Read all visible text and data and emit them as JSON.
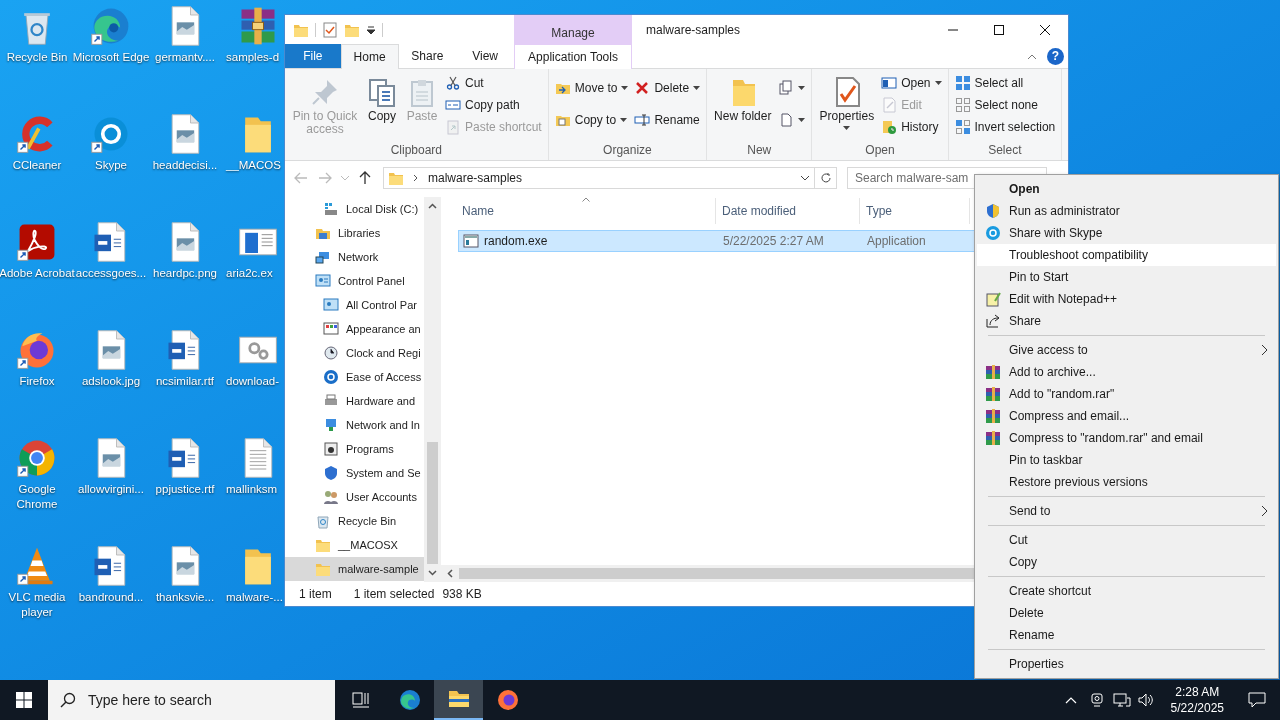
{
  "desktop": {
    "icons": [
      {
        "label": "Recycle Bin",
        "shortcut": false
      },
      {
        "label": "Microsoft Edge",
        "shortcut": true
      },
      {
        "label": "germantv....",
        "shortcut": false
      },
      {
        "label": "samples-d",
        "shortcut": false
      },
      {
        "label": "CCleaner",
        "shortcut": true
      },
      {
        "label": "Skype",
        "shortcut": true
      },
      {
        "label": "headdecisi...",
        "shortcut": false
      },
      {
        "label": "__MACOS",
        "shortcut": false
      },
      {
        "label": "Adobe Acrobat",
        "shortcut": true
      },
      {
        "label": "accessgoes...",
        "shortcut": false
      },
      {
        "label": "heardpc.png",
        "shortcut": false
      },
      {
        "label": "aria2c.ex",
        "shortcut": false
      },
      {
        "label": "Firefox",
        "shortcut": true
      },
      {
        "label": "adslook.jpg",
        "shortcut": false
      },
      {
        "label": "ncsimilar.rtf",
        "shortcut": false
      },
      {
        "label": "download-",
        "shortcut": false
      },
      {
        "label": "Google Chrome",
        "shortcut": true
      },
      {
        "label": "allowvirgini...",
        "shortcut": false
      },
      {
        "label": "ppjustice.rtf",
        "shortcut": false
      },
      {
        "label": "mallinksm",
        "shortcut": false
      },
      {
        "label": "VLC media player",
        "shortcut": true
      },
      {
        "label": "bandround...",
        "shortcut": false
      },
      {
        "label": "thanksvie...",
        "shortcut": false
      },
      {
        "label": "malware-...",
        "shortcut": false
      }
    ]
  },
  "explorer": {
    "title": "malware-samples",
    "context_group": "Manage",
    "tabs": [
      {
        "label": "File",
        "kind": "file",
        "selected": false
      },
      {
        "label": "Home",
        "kind": "tab",
        "selected": true
      },
      {
        "label": "Share",
        "kind": "tab",
        "selected": false
      },
      {
        "label": "View",
        "kind": "tab",
        "selected": false
      },
      {
        "label": "Application Tools",
        "kind": "contextual",
        "selected": false
      }
    ],
    "help": "?",
    "ribbon": [
      {
        "label": "Clipboard",
        "columns": [
          [
            {
              "label": "Pin to Quick access",
              "disabled": true,
              "dropdown": false
            }
          ],
          [
            {
              "label": "Copy",
              "disabled": false,
              "dropdown": false
            }
          ],
          [
            {
              "label": "Paste",
              "disabled": true,
              "dropdown": false
            }
          ],
          [
            {
              "label": "Cut",
              "disabled": false,
              "dropdown": false
            },
            {
              "label": "Copy path",
              "disabled": false,
              "dropdown": false
            },
            {
              "label": "Paste shortcut",
              "disabled": true,
              "dropdown": false
            }
          ]
        ]
      },
      {
        "label": "Organize",
        "columns": [
          [
            {
              "label": "Move to",
              "disabled": false,
              "dropdown": true
            },
            {
              "label": "Copy to",
              "disabled": false,
              "dropdown": true
            }
          ],
          [
            {
              "label": "Delete",
              "disabled": false,
              "dropdown": true
            },
            {
              "label": "Rename",
              "disabled": false,
              "dropdown": false
            }
          ]
        ]
      },
      {
        "label": "New",
        "columns": [
          [
            {
              "label": "New folder",
              "disabled": false,
              "dropdown": false
            }
          ],
          [
            {
              "disabled": false,
              "dropdown": true
            },
            {
              "disabled": false,
              "dropdown": true
            }
          ]
        ]
      },
      {
        "label": "Open",
        "columns": [
          [
            {
              "label": "Properties",
              "disabled": false,
              "dropdown": true
            }
          ],
          [
            {
              "label": "Open",
              "disabled": false,
              "dropdown": true
            },
            {
              "label": "Edit",
              "disabled": true,
              "dropdown": false
            },
            {
              "label": "History",
              "disabled": false,
              "dropdown": false
            }
          ]
        ]
      },
      {
        "label": "Select",
        "columns": [
          [
            {
              "label": "Select all",
              "disabled": false,
              "dropdown": false
            },
            {
              "label": "Select none",
              "disabled": false,
              "dropdown": false
            },
            {
              "label": "Invert selection",
              "disabled": false,
              "dropdown": false
            }
          ]
        ]
      }
    ],
    "address": "malware-samples",
    "search_placeholder": "Search malware-sam",
    "nav_pane": {
      "partial_group": [
        {
          "label": "Local Disk (C:)",
          "selected": false
        }
      ],
      "items": [
        {
          "label": "Libraries",
          "selected": false
        },
        {
          "label": "Network",
          "selected": false
        },
        {
          "label": "Control Panel",
          "selected": false,
          "children": [
            {
              "label": "All Control Par",
              "selected": false
            },
            {
              "label": "Appearance an",
              "selected": false
            },
            {
              "label": "Clock and Regi",
              "selected": false
            },
            {
              "label": "Ease of Access",
              "selected": false
            },
            {
              "label": "Hardware and",
              "selected": false
            },
            {
              "label": "Network and In",
              "selected": false
            },
            {
              "label": "Programs",
              "selected": false
            },
            {
              "label": "System and Se",
              "selected": false
            },
            {
              "label": "User Accounts",
              "selected": false
            }
          ]
        },
        {
          "label": "Recycle Bin",
          "selected": false
        },
        {
          "label": "__MACOSX",
          "selected": false
        },
        {
          "label": "malware-sample",
          "selected": true
        }
      ]
    },
    "columns": [
      {
        "label": "Name",
        "sorted": true
      },
      {
        "label": "Date modified",
        "sorted": false
      },
      {
        "label": "Type",
        "sorted": false
      }
    ],
    "rows": [
      {
        "cells": [
          "random.exe",
          "5/22/2025 2:27 AM",
          "Application"
        ],
        "selected": true
      }
    ],
    "status": [
      "1 item",
      "1 item selected",
      "938 KB"
    ]
  },
  "context_menu": {
    "sections": [
      [
        {
          "label": "Open",
          "default": true,
          "selected": false,
          "submenu": false
        },
        {
          "label": "Run as administrator",
          "default": false,
          "selected": false,
          "submenu": false
        },
        {
          "label": "Share with Skype",
          "default": false,
          "selected": false,
          "submenu": false
        },
        {
          "label": "Troubleshoot compatibility",
          "default": false,
          "selected": true,
          "submenu": false
        },
        {
          "label": "Pin to Start",
          "default": false,
          "selected": false,
          "submenu": false
        },
        {
          "label": "Edit with Notepad++",
          "default": false,
          "selected": false,
          "submenu": false
        },
        {
          "label": "Share",
          "default": false,
          "selected": false,
          "submenu": false
        }
      ],
      [
        {
          "label": "Give access to",
          "default": false,
          "selected": false,
          "submenu": true
        },
        {
          "label": "Add to archive...",
          "default": false,
          "selected": false,
          "submenu": false
        },
        {
          "label": "Add to \"random.rar\"",
          "default": false,
          "selected": false,
          "submenu": false
        },
        {
          "label": "Compress and email...",
          "default": false,
          "selected": false,
          "submenu": false
        },
        {
          "label": "Compress to \"random.rar\" and email",
          "default": false,
          "selected": false,
          "submenu": false
        },
        {
          "label": "Pin to taskbar",
          "default": false,
          "selected": false,
          "submenu": false
        },
        {
          "label": "Restore previous versions",
          "default": false,
          "selected": false,
          "submenu": false
        }
      ],
      [
        {
          "label": "Send to",
          "default": false,
          "selected": false,
          "submenu": true
        }
      ],
      [
        {
          "label": "Cut",
          "default": false,
          "selected": false,
          "submenu": false
        },
        {
          "label": "Copy",
          "default": false,
          "selected": false,
          "submenu": false
        }
      ],
      [
        {
          "label": "Create shortcut",
          "default": false,
          "selected": false,
          "submenu": false
        },
        {
          "label": "Delete",
          "default": false,
          "selected": false,
          "submenu": false
        },
        {
          "label": "Rename",
          "default": false,
          "selected": false,
          "submenu": false
        }
      ],
      [
        {
          "label": "Properties",
          "default": false,
          "selected": false,
          "submenu": false
        }
      ]
    ]
  },
  "taskbar": {
    "search_placeholder": "Type here to search",
    "apps": [
      {
        "active": false
      },
      {
        "active": true
      },
      {
        "active": false
      }
    ],
    "time": "2:28 AM",
    "date": "5/22/2025"
  }
}
